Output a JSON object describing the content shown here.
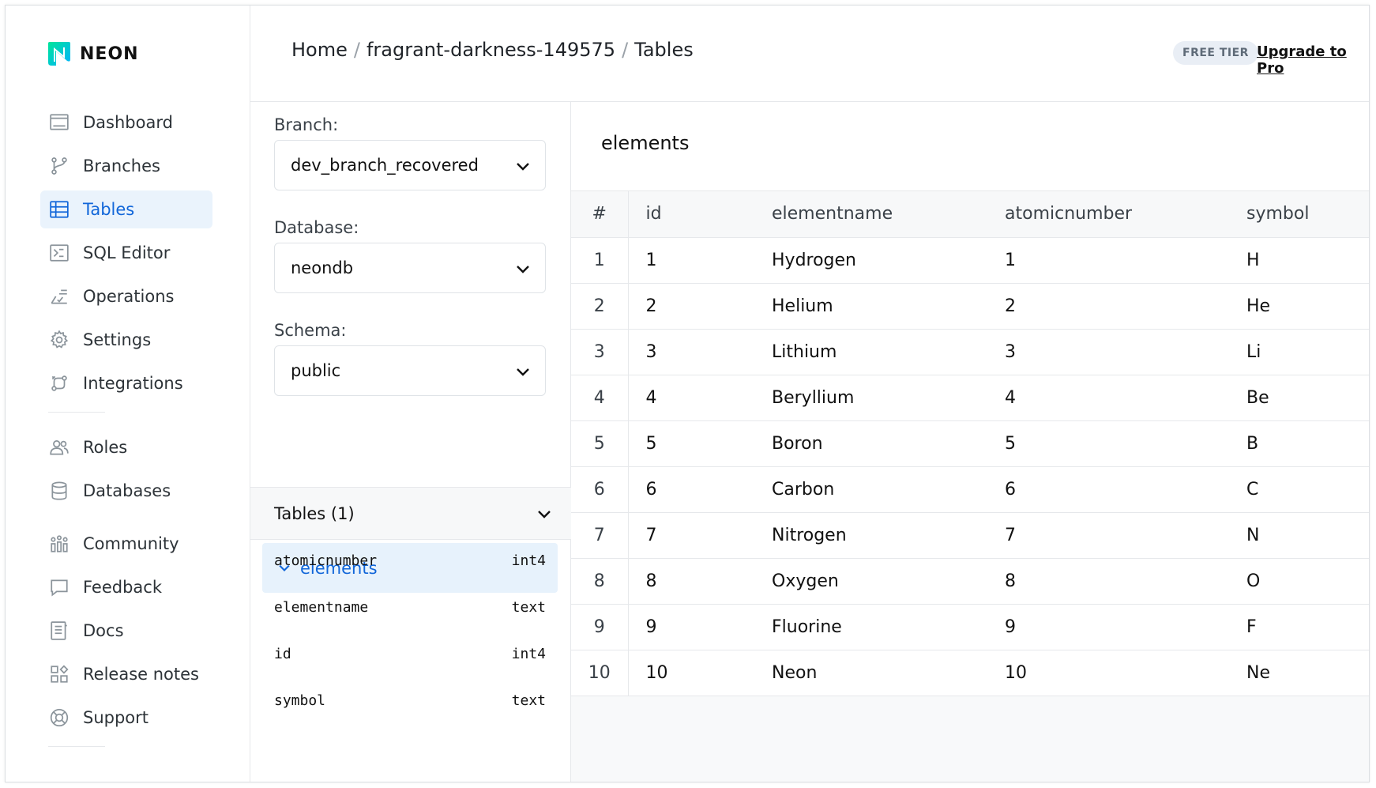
{
  "app": {
    "logo_text": "NEON",
    "brand_color": "#00e599"
  },
  "sidebar": {
    "items": [
      {
        "label": "Dashboard",
        "icon": "dashboard-icon"
      },
      {
        "label": "Branches",
        "icon": "branch-icon"
      },
      {
        "label": "Tables",
        "icon": "table-icon",
        "active": true
      },
      {
        "label": "SQL Editor",
        "icon": "sql-editor-icon"
      },
      {
        "label": "Operations",
        "icon": "operations-icon"
      },
      {
        "label": "Settings",
        "icon": "gear-icon"
      },
      {
        "label": "Integrations",
        "icon": "integrations-icon"
      }
    ],
    "items2": [
      {
        "label": "Roles",
        "icon": "users-icon"
      },
      {
        "label": "Databases",
        "icon": "database-icon"
      }
    ],
    "items3": [
      {
        "label": "Community",
        "icon": "community-icon"
      },
      {
        "label": "Feedback",
        "icon": "chat-icon"
      },
      {
        "label": "Docs",
        "icon": "docs-icon"
      },
      {
        "label": "Release notes",
        "icon": "release-notes-icon"
      },
      {
        "label": "Support",
        "icon": "support-icon"
      }
    ]
  },
  "header": {
    "breadcrumb": [
      "Home",
      "fragrant-darkness-149575",
      "Tables"
    ],
    "separator": "/",
    "plan_badge": "FREE TIER",
    "upgrade_link": "Upgrade to Pro"
  },
  "filters": {
    "branch_label": "Branch:",
    "branch_value": "dev_branch_recovered",
    "database_label": "Database:",
    "database_value": "neondb",
    "schema_label": "Schema:",
    "schema_value": "public"
  },
  "tables_panel": {
    "header": "Tables (1)",
    "selected_table": "elements",
    "columns": [
      {
        "name": "atomicnumber",
        "type": "int4"
      },
      {
        "name": "elementname",
        "type": "text"
      },
      {
        "name": "id",
        "type": "int4"
      },
      {
        "name": "symbol",
        "type": "text"
      }
    ]
  },
  "main": {
    "title": "elements",
    "headers": [
      "#",
      "id",
      "elementname",
      "atomicnumber",
      "symbol"
    ],
    "rows": [
      [
        "1",
        "1",
        "Hydrogen",
        "1",
        "H"
      ],
      [
        "2",
        "2",
        "Helium",
        "2",
        "He"
      ],
      [
        "3",
        "3",
        "Lithium",
        "3",
        "Li"
      ],
      [
        "4",
        "4",
        "Beryllium",
        "4",
        "Be"
      ],
      [
        "5",
        "5",
        "Boron",
        "5",
        "B"
      ],
      [
        "6",
        "6",
        "Carbon",
        "6",
        "C"
      ],
      [
        "7",
        "7",
        "Nitrogen",
        "7",
        "N"
      ],
      [
        "8",
        "8",
        "Oxygen",
        "8",
        "O"
      ],
      [
        "9",
        "9",
        "Fluorine",
        "9",
        "F"
      ],
      [
        "10",
        "10",
        "Neon",
        "10",
        "Ne"
      ]
    ]
  }
}
